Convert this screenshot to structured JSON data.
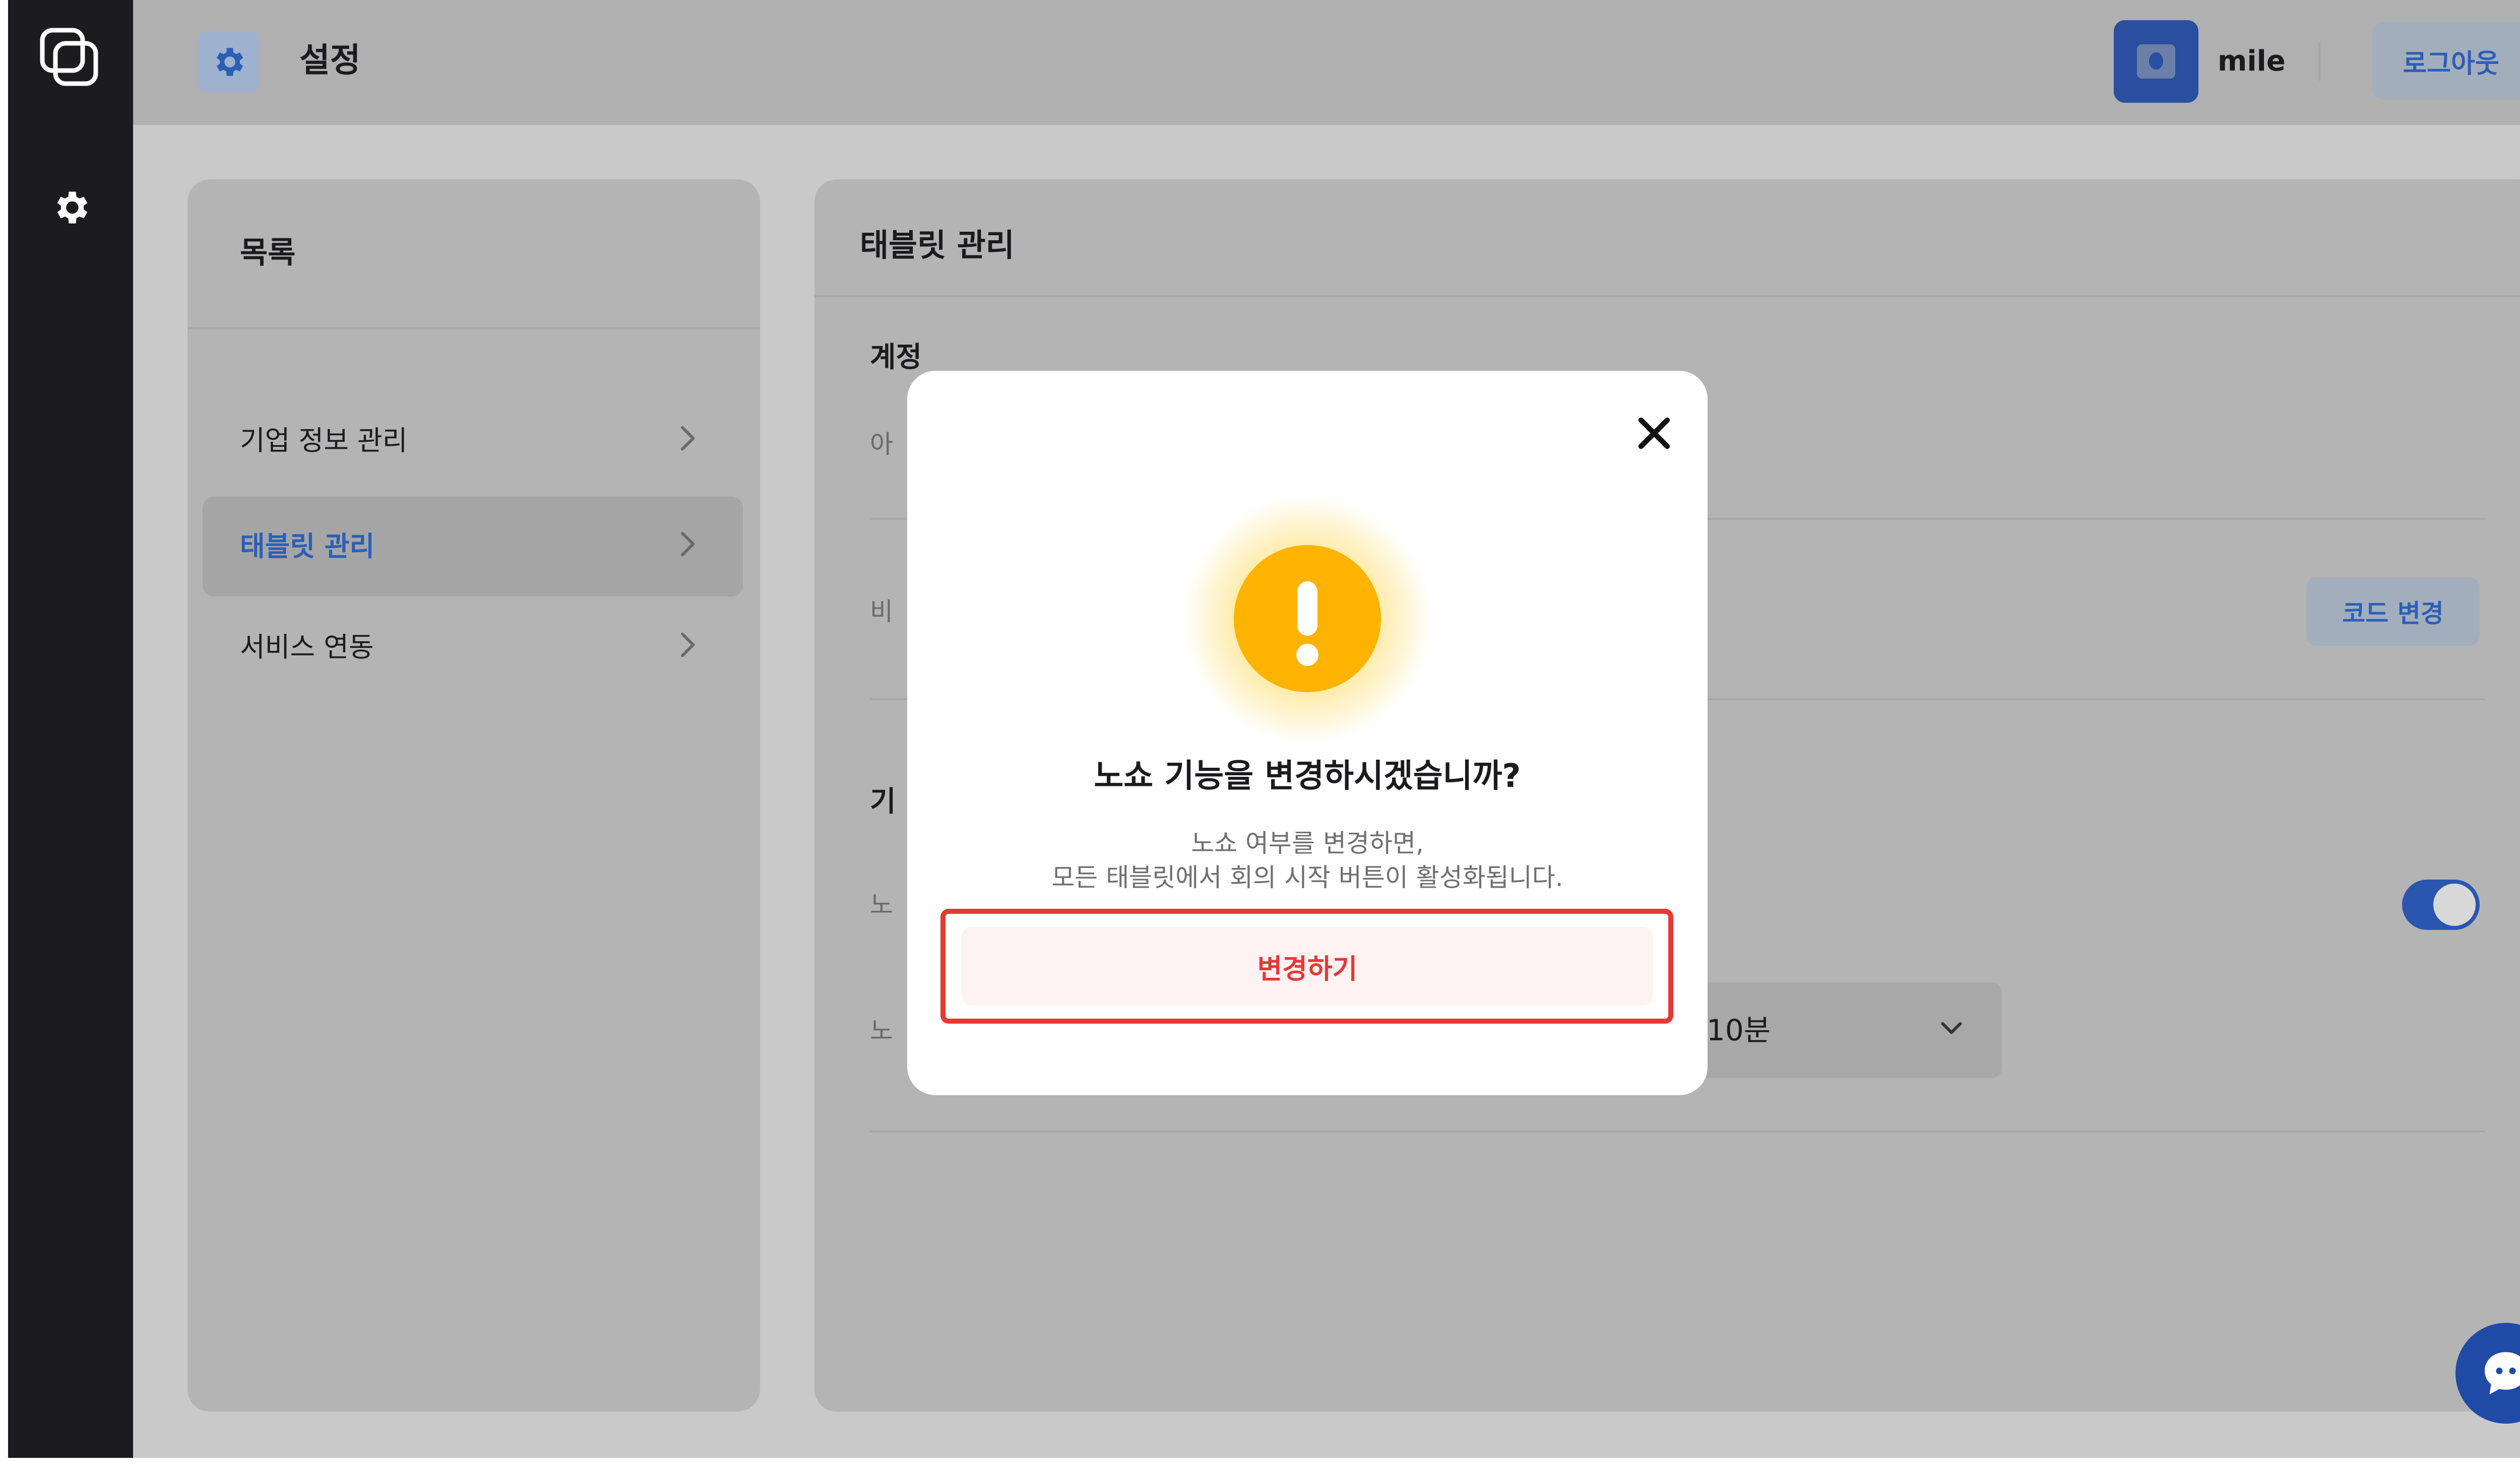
{
  "app": {
    "page_title": "설정",
    "username": "mile",
    "logout_label": "로그아웃"
  },
  "sidebar_list": {
    "title": "목록",
    "items": [
      {
        "label": "기업 정보 관리"
      },
      {
        "label": "태블릿 관리",
        "active": true
      },
      {
        "label": "서비스 연동"
      }
    ]
  },
  "content": {
    "title": "태블릿 관리",
    "section_account": "계정",
    "row_id_label_fragment": "아",
    "row_pw_label_fragment": "비",
    "code_change_label": "코드 변경",
    "section_feature_fragment": "기",
    "row_noshow_fragment": "노",
    "row_noshow_time_fragment": "노",
    "noshow_time_value": "10분",
    "noshow_toggle_on": true
  },
  "modal": {
    "title": "노쇼 기능을 변경하시겠습니까?",
    "desc_line1": "노쇼 여부를 변경하면,",
    "desc_line2": "모든 태블릿에서 회의 시작 버튼이 활성화됩니다.",
    "confirm_label": "변경하기"
  },
  "colors": {
    "accent": "#2b5fb6",
    "warning": "#fdb300",
    "danger": "#e53935",
    "rail": "#1c1c1e"
  },
  "icons": {
    "rail_logo": "app-logo-icon",
    "rail_settings": "gear-icon",
    "header_settings": "gear-icon",
    "close": "close-icon",
    "warning": "exclamation-icon",
    "chevron": "chevron-right-icon",
    "dropdown": "chevron-down-icon",
    "chat": "chat-bubble-icon"
  }
}
